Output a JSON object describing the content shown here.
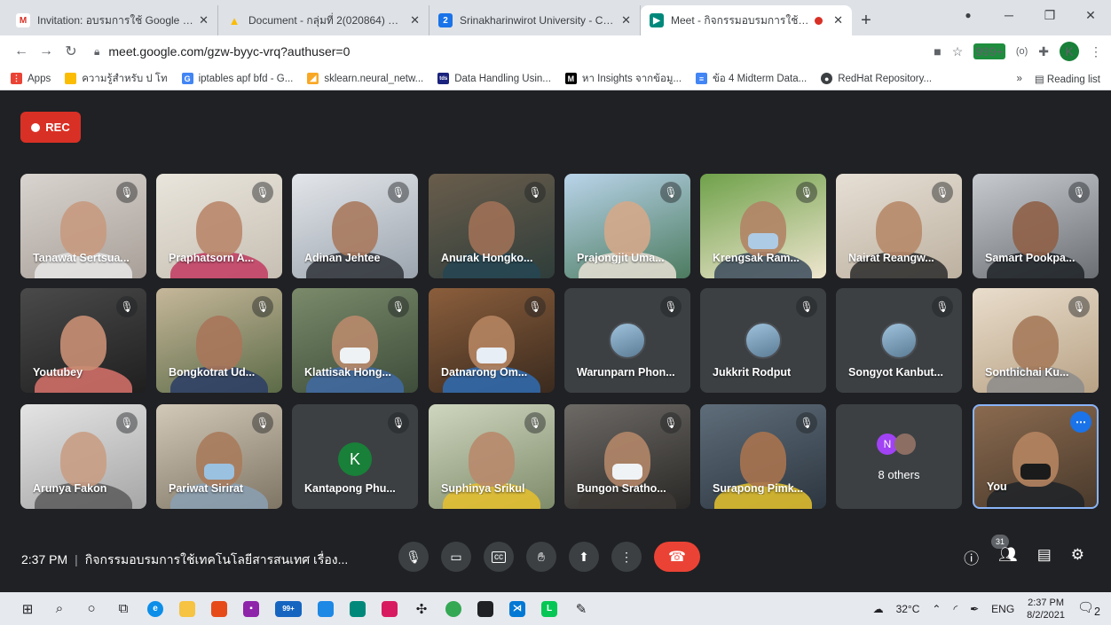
{
  "browser": {
    "tabs": [
      {
        "title": "Invitation: อบรมการใช้ Google @ F",
        "icon": "gmail-icon",
        "color": "#d93025",
        "glyph": "M"
      },
      {
        "title": "Document - กลุ่มที่ 2(020864) อบรม",
        "icon": "drive-icon",
        "color": "#fbbc04",
        "glyph": "▲"
      },
      {
        "title": "Srinakharinwirot University - Cale",
        "icon": "calendar-icon",
        "color": "#1a73e8",
        "glyph": "2"
      },
      {
        "title": "Meet - กิจกรรมอบรมการใช้เทคโ",
        "icon": "meet-icon",
        "color": "#00897b",
        "glyph": "▶"
      }
    ],
    "new_tab": "+",
    "url": "meet.google.com/gzw-byyc-vrq?authuser=0",
    "badge_999": "999+",
    "profile_letter": "K",
    "bookmarks": [
      {
        "label": "Apps",
        "color": "#ea4335",
        "glyph": "⋮"
      },
      {
        "label": "ความรู้สำหรับ ป โท",
        "color": "#fbbc04",
        "glyph": ""
      },
      {
        "label": "iptables apf bfd - G...",
        "color": "#4285f4",
        "glyph": "G"
      },
      {
        "label": "sklearn.neural_netw...",
        "color": "#f9a825",
        "glyph": "◢"
      },
      {
        "label": "Data Handling Usin...",
        "color": "#1a237e",
        "glyph": "tds"
      },
      {
        "label": "หา Insights จากข้อมู...",
        "color": "#000000",
        "glyph": "M"
      },
      {
        "label": "ข้อ 4 Midterm Data...",
        "color": "#4285f4",
        "glyph": "≡"
      },
      {
        "label": "RedHat Repository...",
        "color": "#3c4043",
        "glyph": "●"
      }
    ],
    "bookmarks_more": "»",
    "reading_list": "Reading list"
  },
  "meet": {
    "rec_label": "REC",
    "participants": [
      {
        "name": "Tanawat Sertsua...",
        "type": "video",
        "c1": "#d9d4cf",
        "c2": "#a89f98",
        "skin": "#c79a7f",
        "shirt": "#e8e8e8"
      },
      {
        "name": "Praphatsorn A...",
        "type": "video",
        "c1": "#e9e5dc",
        "c2": "#c7bfb3",
        "skin": "#b9876b",
        "shirt": "#c23a60"
      },
      {
        "name": "Adinan Jehtee",
        "type": "video",
        "c1": "#e3e6ea",
        "c2": "#9ba4ae",
        "skin": "#a97a5e",
        "shirt": "#2f3338"
      },
      {
        "name": "Anurak Hongko...",
        "type": "video",
        "c1": "#6a5d4c",
        "c2": "#2f3d3a",
        "skin": "#9f7156",
        "shirt": "#264653"
      },
      {
        "name": "Prajongjit Uma...",
        "type": "video",
        "c1": "#b9d4ea",
        "c2": "#4c7b5f",
        "skin": "#d4a88a",
        "shirt": "#e7e0d5"
      },
      {
        "name": "Krengsak Ram...",
        "type": "video",
        "c1": "#6fa14a",
        "c2": "#efe6cf",
        "skin": "#b18466",
        "shirt": "#3a4a5c",
        "mask": "#aecbe6"
      },
      {
        "name": "Nairat Reangw...",
        "type": "video",
        "c1": "#e6dfd5",
        "c2": "#bdb1a0",
        "skin": "#b7896a",
        "shirt": "#2b2b2b"
      },
      {
        "name": "Samart Pookpa...",
        "type": "video",
        "c1": "#c7cbd0",
        "c2": "#6b6f74",
        "skin": "#8f6048",
        "shirt": "#1f2328"
      },
      {
        "name": "Youtubey",
        "type": "video",
        "c1": "#4a4a4a",
        "c2": "#1f1f1f",
        "skin": "#c98f74",
        "shirt": "#d9726b"
      },
      {
        "name": "Bongkotrat Ud...",
        "type": "video",
        "c1": "#c6b79a",
        "c2": "#5c6b47",
        "skin": "#a9765a",
        "shirt": "#2a3d66"
      },
      {
        "name": "Klattisak Hong...",
        "type": "video",
        "c1": "#7a8a6a",
        "c2": "#3d4d3a",
        "skin": "#b88a6b",
        "shirt": "#3f6aa5",
        "mask": "#eef2f5"
      },
      {
        "name": "Datnarong Om...",
        "type": "video",
        "c1": "#8b5e3c",
        "c2": "#3a2a1e",
        "skin": "#b58461",
        "shirt": "#2f6cb3",
        "mask": "#e8eef5"
      },
      {
        "name": "Warunparn Phon...",
        "type": "avatar"
      },
      {
        "name": "Jukkrit Rodput",
        "type": "avatar"
      },
      {
        "name": "Songyot Kanbut...",
        "type": "avatar"
      },
      {
        "name": "Sonthichai Ku...",
        "type": "video",
        "c1": "#e9ddcc",
        "c2": "#b8a285",
        "skin": "#a67b5b",
        "shirt": "#8c8c8c"
      },
      {
        "name": "Arunya Fakon",
        "type": "video",
        "c1": "#e4e4e4",
        "c2": "#a6a6a6",
        "skin": "#c99d84",
        "shirt": "#5a5a5a"
      },
      {
        "name": "Pariwat Sirirat",
        "type": "video",
        "c1": "#d3c9b8",
        "c2": "#7f7565",
        "skin": "#a97b5c",
        "shirt": "#8aa0b4",
        "mask": "#9bc1e0"
      },
      {
        "name": "Kantapong Phu...",
        "type": "letter",
        "letter": "K"
      },
      {
        "name": "Suphinya Srikul",
        "type": "video",
        "c1": "#cfd6bf",
        "c2": "#7e8b6a",
        "skin": "#b88a6b",
        "shirt": "#e7c12d"
      },
      {
        "name": "Bungon Sratho...",
        "type": "video",
        "c1": "#6d6a66",
        "c2": "#2a2826",
        "skin": "#b38668",
        "shirt": "#3d3a36",
        "mask": "#f0f3f6"
      },
      {
        "name": "Surapong Pimk...",
        "type": "video",
        "c1": "#5f6d7a",
        "c2": "#2c3640",
        "skin": "#a9734f",
        "shirt": "#e6c32b"
      },
      {
        "name": "8 others",
        "type": "others",
        "letter": "N"
      },
      {
        "name": "You",
        "type": "self",
        "c1": "#8a6a4f",
        "c2": "#4a3a2c",
        "skin": "#b58461",
        "shirt": "#1f2328",
        "mask": "#1b1b1b"
      }
    ],
    "time": "2:37 PM",
    "meeting_title": "กิจกรรมอบรมการใช้เทคโนโลยีสารสนเทศ เรื่อง...",
    "participant_count": "31"
  },
  "taskbar": {
    "temperature": "32°C",
    "language": "ENG",
    "clock_time": "2:37 PM",
    "clock_date": "8/2/2021",
    "badge_99": "99+",
    "notifications": "2"
  }
}
